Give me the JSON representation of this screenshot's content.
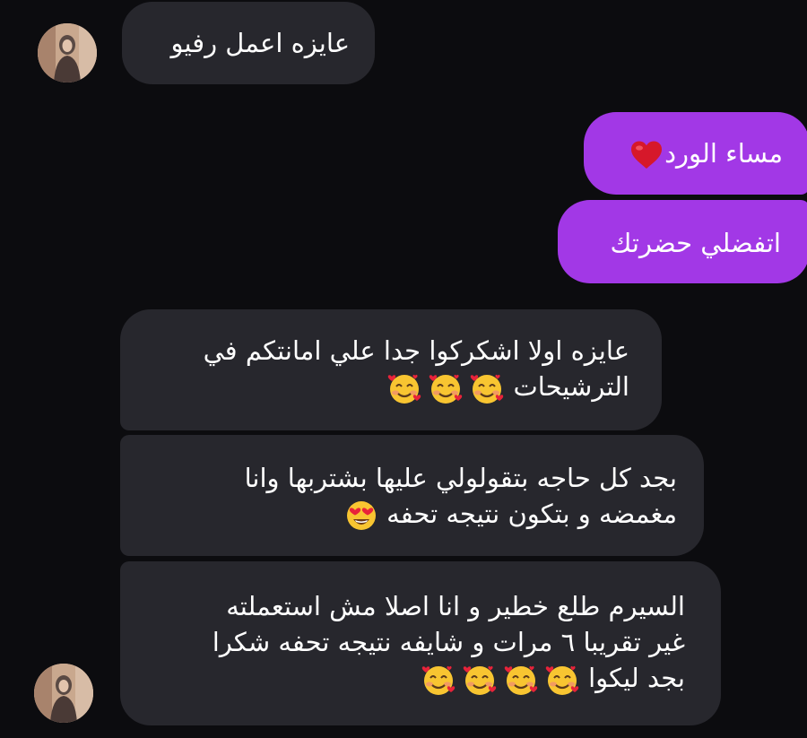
{
  "conversation": {
    "messages": [
      {
        "side": "in",
        "lines": [
          "عايزه اعمل رفيو"
        ]
      },
      {
        "side": "out",
        "lines": [
          "مساء الورد"
        ],
        "emoji": [
          "red-heart"
        ]
      },
      {
        "side": "out",
        "lines": [
          "اتفضلي حضرتك"
        ]
      },
      {
        "side": "in",
        "lines": [
          "عايزه اولا اشكركوا جدا علي امانتكم في",
          "الترشيحات"
        ],
        "emoji": [
          "smiling-face-with-hearts",
          "smiling-face-with-hearts",
          "smiling-face-with-hearts"
        ]
      },
      {
        "side": "in",
        "lines": [
          "بجد كل حاجه بتقولولي عليها بشتربها وانا",
          "مغمضه و بتكون نتيجه تحفه"
        ],
        "emoji": [
          "heart-eyes"
        ]
      },
      {
        "side": "in",
        "lines": [
          "السيرم طلع خطير و انا اصلا مش استعملته",
          "غير تقريبا ٦ مرات و شايفه نتيجه تحفه شكرا",
          "بجد ليكوا"
        ],
        "emoji": [
          "smiling-face-with-hearts",
          "smiling-face-with-hearts",
          "smiling-face-with-hearts",
          "smiling-face-with-hearts"
        ]
      }
    ]
  },
  "colors": {
    "background": "#0c0c0f",
    "incoming_bubble": "#27272d",
    "outgoing_bubble": "#a238e6",
    "text": "#ffffff"
  }
}
